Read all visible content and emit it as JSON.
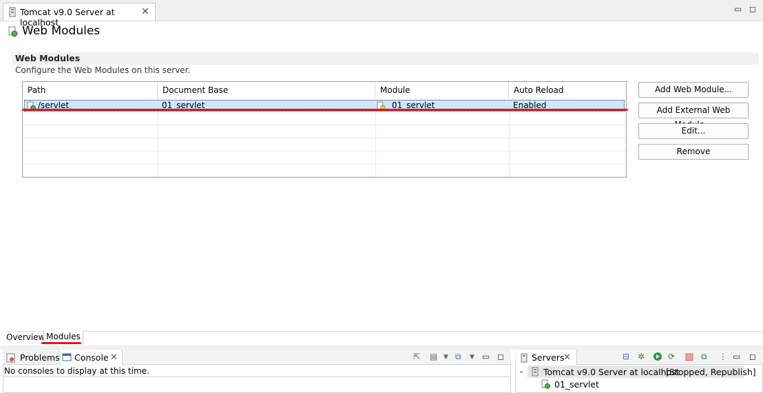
{
  "editor_tab": {
    "title": "Tomcat v9.0 Server at localhost",
    "close": "✕"
  },
  "window_controls": {
    "minimize": "▭",
    "maximize": "◻"
  },
  "page": {
    "title": "Web Modules",
    "section_title": "Web Modules",
    "section_description": "Configure the Web Modules on this server."
  },
  "table": {
    "columns": [
      "Path",
      "Document Base",
      "Module",
      "Auto Reload"
    ],
    "rows": [
      {
        "path": "/servlet",
        "document_base": "01_servlet",
        "module": "01_servlet",
        "auto_reload": "Enabled"
      }
    ]
  },
  "buttons": {
    "add_web_module": "Add Web Module...",
    "add_external_web_module": "Add External Web Module...",
    "edit": "Edit...",
    "remove": "Remove"
  },
  "editor_bottom_tabs": {
    "overview": "Overview",
    "modules": "Modules"
  },
  "console_view": {
    "tabs": {
      "problems": "Problems",
      "console": "Console"
    },
    "message": "No consoles to display at this time."
  },
  "servers_view": {
    "tab": "Servers",
    "server_name": "Tomcat v9.0 Server at localhost",
    "server_status": "[Stopped, Republish]",
    "module": "01_servlet"
  },
  "colors": {
    "highlight_red": "#e0151f",
    "selection": "#cce8ff",
    "section_bg": "#f0f0f0"
  }
}
